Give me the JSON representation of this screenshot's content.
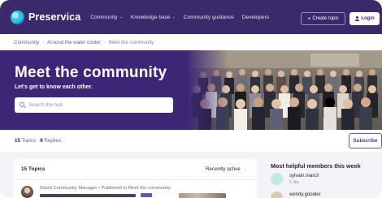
{
  "nav": {
    "brand": "Preservica",
    "links": [
      {
        "label": "Community",
        "has_dropdown": true
      },
      {
        "label": "Knowledge base",
        "has_dropdown": true
      },
      {
        "label": "Community guidance",
        "has_dropdown": false
      },
      {
        "label": "Developers",
        "has_dropdown": false
      }
    ],
    "create_topic_label": "Create topic",
    "login_label": "Login"
  },
  "breadcrumb": {
    "items": [
      "Community",
      "Around the water cooler"
    ],
    "current": "Meet the community"
  },
  "hero": {
    "title": "Meet the community",
    "subtitle": "Let's get to know each other.",
    "search_placeholder": "Search the hub",
    "search_value": ""
  },
  "stats": {
    "topics_count": "15",
    "topics_label": "Topics",
    "replies_count": "9",
    "replies_label": "Replies",
    "subscribe_label": "Subscribe"
  },
  "topics": {
    "header": "15 Topics",
    "sort_label": "Recently active",
    "items": [
      {
        "author": "David",
        "meta": "Community Manager • Published in Meet the community"
      }
    ]
  },
  "members": {
    "title": "Most helpful members this week",
    "items": [
      {
        "name": "sylvain.marcil",
        "likes": "1 like",
        "avatar_color": "#bfe9e4"
      },
      {
        "name": "wendy.goodier",
        "likes": "",
        "avatar_color": "#d9cbb5"
      }
    ]
  },
  "colors": {
    "nav_bg": "#3b2a6b",
    "hero_bg": "#3d2676",
    "accent": "#6b56b8",
    "page_bg": "#f4f3f7"
  }
}
